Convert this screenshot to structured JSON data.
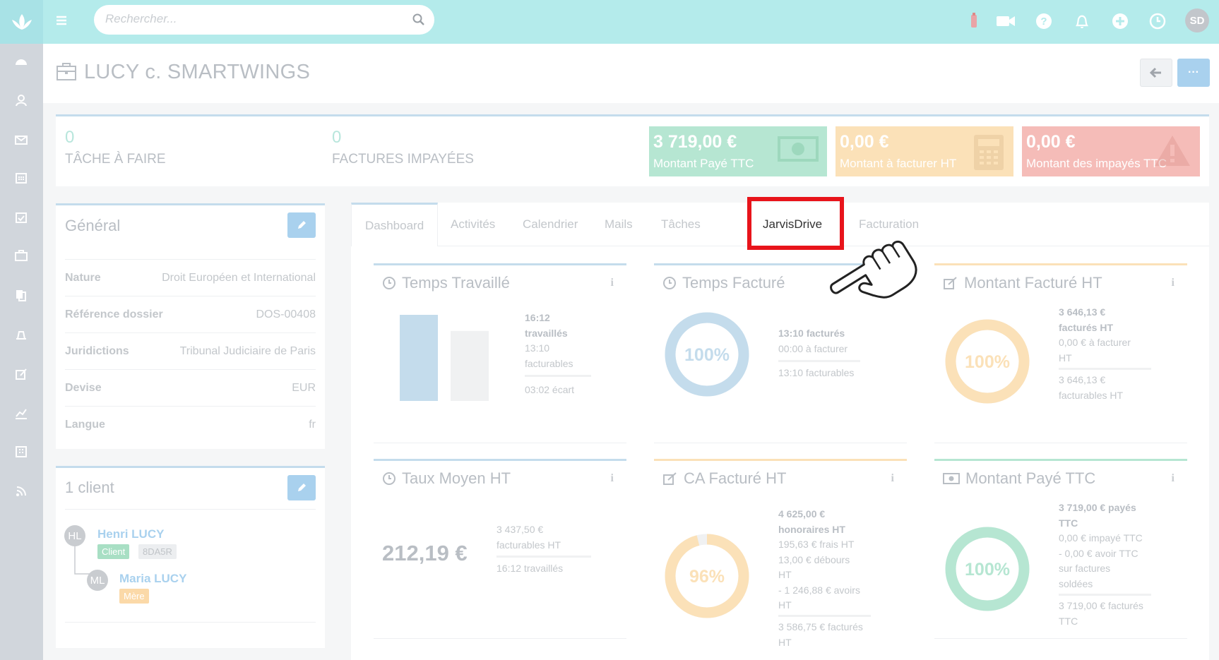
{
  "search": {
    "placeholder": "Rechercher..."
  },
  "user": {
    "initials": "SD"
  },
  "page": {
    "title": "LUCY c. SMARTWINGS",
    "more_label": "···"
  },
  "stats": {
    "tasks": {
      "value": "0",
      "label": "TÂCHE À FAIRE"
    },
    "unpaid": {
      "value": "0",
      "label": "FACTURES IMPAYÉES"
    },
    "cards": [
      {
        "value": "3 719,00 €",
        "label": "Montant Payé TTC",
        "color": "#b6e6d2"
      },
      {
        "value": "0,00 €",
        "label": "Montant à facturer HT",
        "color": "#fbe1b8"
      },
      {
        "value": "0,00 €",
        "label": "Montant des impayés TTC",
        "color": "#f5bcb8"
      }
    ]
  },
  "general": {
    "title": "Général",
    "rows": [
      {
        "key": "Nature",
        "value": "Droit Européen et International"
      },
      {
        "key": "Référence dossier",
        "value": "DOS-00408"
      },
      {
        "key": "Juridictions",
        "value": "Tribunal Judiciaire de Paris"
      },
      {
        "key": "Devise",
        "value": "EUR"
      },
      {
        "key": "Langue",
        "value": "fr"
      }
    ]
  },
  "clients": {
    "title": "1 client",
    "items": [
      {
        "initials": "HL",
        "name": "Henri LUCY",
        "tags": [
          "Client",
          "8DA5R"
        ]
      },
      {
        "initials": "ML",
        "name": "Maria LUCY",
        "tags": [
          "Mère"
        ]
      }
    ]
  },
  "tabs": [
    "Dashboard",
    "Activités",
    "Calendrier",
    "Mails",
    "Tâches",
    "JarvisDrive",
    "Facturation"
  ],
  "cards": {
    "temps_travaille": {
      "title": "Temps Travaillé",
      "lines": [
        "16:12",
        "travaillés",
        "13:10",
        "facturables",
        "03:02 écart"
      ],
      "bars": {
        "worked": 16.2,
        "billable": 13.17
      }
    },
    "temps_facture": {
      "title": "Temps Facturé",
      "percent": "100%",
      "percent_value": 100,
      "lines": [
        "13:10 facturés",
        "00:00 à facturer",
        "13:10 facturables"
      ]
    },
    "montant_facture": {
      "title": "Montant Facturé HT",
      "percent": "100%",
      "percent_value": 100,
      "lines": [
        "3 646,13 €",
        "facturés HT",
        "0,00 € à facturer",
        "HT",
        "3 646,13 €",
        "facturables HT"
      ]
    },
    "taux_moyen": {
      "title": "Taux Moyen HT",
      "value": "212,19 €",
      "lines": [
        "3 437,50 €",
        "facturables HT",
        "16:12 travaillés"
      ]
    },
    "ca_facture": {
      "title": "CA Facturé HT",
      "percent": "96%",
      "percent_value": 96,
      "lines": [
        "4 625,00 €",
        "honoraires HT",
        "195,63 € frais HT",
        "13,00 € débours",
        "HT",
        "- 1 246,88 € avoirs",
        "HT",
        "3 586,75 € facturés",
        "HT"
      ]
    },
    "montant_paye": {
      "title": "Montant Payé TTC",
      "percent": "100%",
      "percent_value": 100,
      "lines": [
        "3 719,00 € payés",
        "TTC",
        "0,00 € impayé TTC",
        "- 0,00 € avoir TTC",
        "sur factures",
        "soldées",
        "3 719,00 € facturés",
        "TTC"
      ]
    },
    "info_label": "i"
  }
}
